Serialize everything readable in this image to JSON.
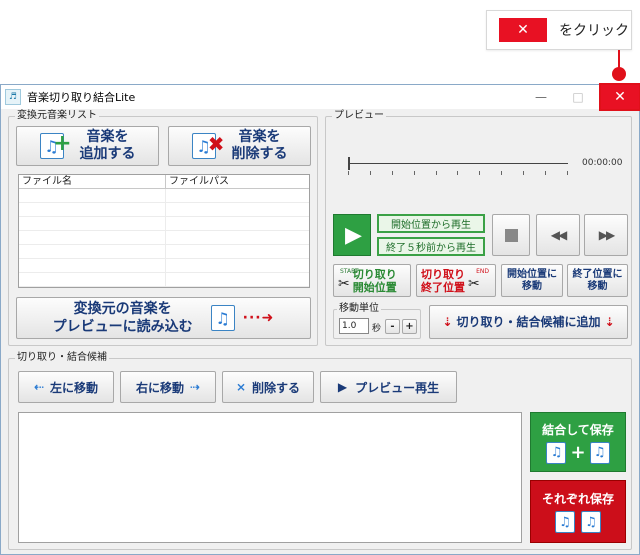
{
  "callout": {
    "close_glyph": "✕",
    "text": "をクリック"
  },
  "window": {
    "title": "音楽切り取り結合Lite",
    "app_icon_glyph": "♬",
    "controls": {
      "minimize": "—",
      "maximize": "□",
      "close": "✕"
    }
  },
  "source_list": {
    "group_label": "変換元音楽リスト",
    "add_button": [
      "音楽を",
      "追加する"
    ],
    "delete_button": [
      "音楽を",
      "削除する"
    ],
    "columns": [
      "ファイル名",
      "ファイルパス"
    ],
    "load_button": [
      "変換元の音楽を",
      "プレビューに読み込む"
    ]
  },
  "preview": {
    "group_label": "プレビュー",
    "time": "00:00:00",
    "play_from_start": "開始位置から再生",
    "play_last_5s": "終了５秒前から再生",
    "cut_start": [
      "切り取り",
      "開始位置"
    ],
    "cut_end": [
      "切り取り",
      "終了位置"
    ],
    "cut_start_tag": "START",
    "cut_end_tag": "END",
    "move_to_start": [
      "開始位置に",
      "移動"
    ],
    "move_to_end": [
      "終了位置に",
      "移動"
    ],
    "unit_group_label": "移動単位",
    "unit_value": "1.0",
    "unit_suffix": "秒",
    "minus": "-",
    "plus": "+",
    "add_candidate": "切り取り・結合候補に追加"
  },
  "candidates": {
    "group_label": "切り取り・結合候補",
    "move_left": "左に移動",
    "move_right": "右に移動",
    "delete": "削除する",
    "play_preview": "プレビュー再生",
    "merge_save": "結合して保存",
    "separate_save": "それぞれ保存"
  },
  "colors": {
    "close_red": "#e81123",
    "accent_blue": "#1a3a78",
    "play_green": "#2ea043",
    "save_green": "#2ea043",
    "save_red": "#cc0e1a"
  }
}
